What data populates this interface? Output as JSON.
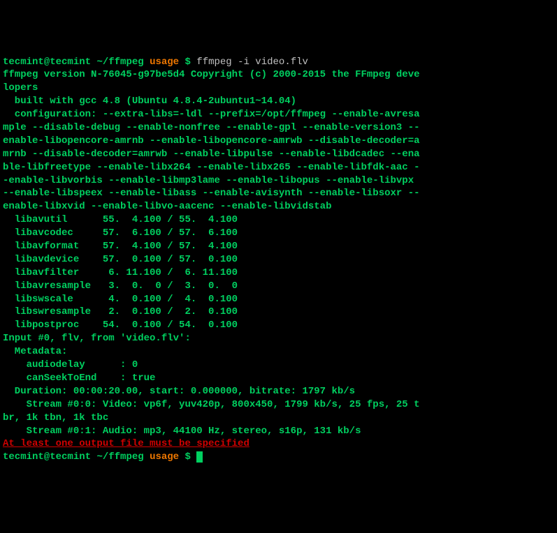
{
  "prompt1": {
    "user": "tecmint@tecmint",
    "path": "~/ffmpeg",
    "segment": "usage",
    "symbol": "$",
    "command": "ffmpeg -i video.flv"
  },
  "output": {
    "line1": "ffmpeg version N-76045-g97be5d4 Copyright (c) 2000-2015 the FFmpeg deve",
    "line2": "lopers",
    "line3": "  built with gcc 4.8 (Ubuntu 4.8.4-2ubuntu1~14.04)",
    "line4": "  configuration: --extra-libs=-ldl --prefix=/opt/ffmpeg --enable-avresa",
    "line5": "mple --disable-debug --enable-nonfree --enable-gpl --enable-version3 --",
    "line6": "enable-libopencore-amrnb --enable-libopencore-amrwb --disable-decoder=a",
    "line7": "mrnb --disable-decoder=amrwb --enable-libpulse --enable-libdcadec --ena",
    "line8": "ble-libfreetype --enable-libx264 --enable-libx265 --enable-libfdk-aac -",
    "line9": "-enable-libvorbis --enable-libmp3lame --enable-libopus --enable-libvpx ",
    "line10": "--enable-libspeex --enable-libass --enable-avisynth --enable-libsoxr --",
    "line11": "enable-libxvid --enable-libvo-aacenc --enable-libvidstab",
    "line12": "  libavutil      55.  4.100 / 55.  4.100",
    "line13": "  libavcodec     57.  6.100 / 57.  6.100",
    "line14": "  libavformat    57.  4.100 / 57.  4.100",
    "line15": "  libavdevice    57.  0.100 / 57.  0.100",
    "line16": "  libavfilter     6. 11.100 /  6. 11.100",
    "line17": "  libavresample   3.  0.  0 /  3.  0.  0",
    "line18": "  libswscale      4.  0.100 /  4.  0.100",
    "line19": "  libswresample   2.  0.100 /  2.  0.100",
    "line20": "  libpostproc    54.  0.100 / 54.  0.100",
    "line21": "Input #0, flv, from 'video.flv':",
    "line22": "  Metadata:",
    "line23": "    audiodelay      : 0",
    "line24": "    canSeekToEnd    : true",
    "line25": "  Duration: 00:00:20.00, start: 0.000000, bitrate: 1797 kb/s",
    "line26": "    Stream #0:0: Video: vp6f, yuv420p, 800x450, 1799 kb/s, 25 fps, 25 t",
    "line27": "br, 1k tbn, 1k tbc",
    "line28": "    Stream #0:1: Audio: mp3, 44100 Hz, stereo, s16p, 131 kb/s"
  },
  "error": "At least one output file must be specified",
  "prompt2": {
    "user": "tecmint@tecmint",
    "path": "~/ffmpeg",
    "segment": "usage",
    "symbol": "$"
  }
}
